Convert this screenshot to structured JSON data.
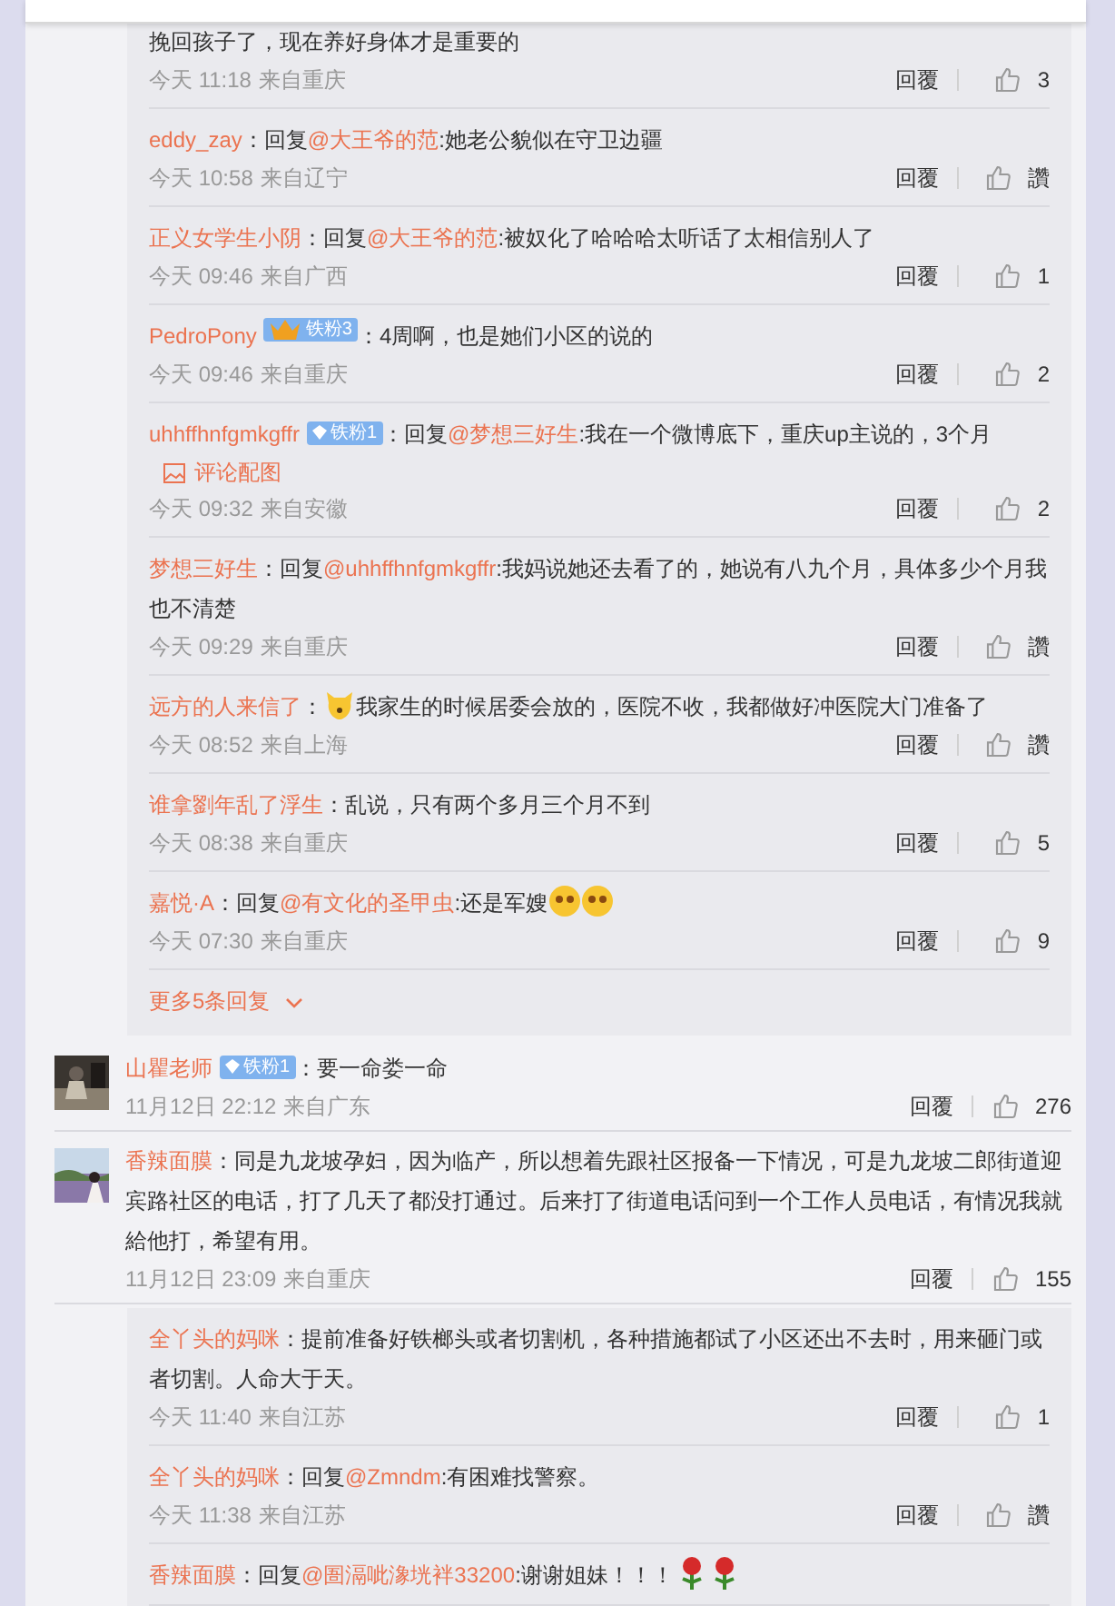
{
  "thread_top": {
    "replies": [
      {
        "content": [
          {
            "kind": "text",
            "text": "挽回孩子了，现在养好身体才是重要的"
          }
        ],
        "time": "今天 11:18",
        "location": "来自重庆",
        "reply": "回覆",
        "likes": "3"
      },
      {
        "author": "eddy_zay",
        "content": [
          {
            "kind": "text",
            "text": "：回复"
          },
          {
            "kind": "mention",
            "text": "@大王爷的范"
          },
          {
            "kind": "text",
            "text": ":她老公貌似在守卫边疆"
          }
        ],
        "time": "今天 10:58",
        "location": "来自辽宁",
        "reply": "回覆",
        "likes": "讚"
      },
      {
        "author": "正义女学生小阴",
        "content": [
          {
            "kind": "text",
            "text": "：回复"
          },
          {
            "kind": "mention",
            "text": "@大王爷的范"
          },
          {
            "kind": "text",
            "text": ":被奴化了哈哈哈太听话了太相信别人了"
          }
        ],
        "time": "今天 09:46",
        "location": "来自广西",
        "reply": "回覆",
        "likes": "1"
      },
      {
        "author": "PedroPony",
        "badge": {
          "kind": "crown",
          "text": "铁粉3"
        },
        "content": [
          {
            "kind": "text",
            "text": "：4周啊，也是她们小区的说的"
          }
        ],
        "time": "今天 09:46",
        "location": "来自重庆",
        "reply": "回覆",
        "likes": "2"
      },
      {
        "author": "uhhffhnfgmkgffr",
        "badge": {
          "kind": "diamond",
          "text": "铁粉1"
        },
        "content": [
          {
            "kind": "text",
            "text": "：回复"
          },
          {
            "kind": "mention",
            "text": "@梦想三好生"
          },
          {
            "kind": "text",
            "text": ":我在一个微博底下，重庆up主说的，3个月"
          }
        ],
        "attachment": "评论配图",
        "time": "今天 09:32",
        "location": "来自安徽",
        "reply": "回覆",
        "likes": "2"
      },
      {
        "author": "梦想三好生",
        "content": [
          {
            "kind": "text",
            "text": "：回复"
          },
          {
            "kind": "mention",
            "text": "@uhhffhnfgmkgffr"
          },
          {
            "kind": "text",
            "text": ":我妈说她还去看了的，她说有八九个月，具体多少个月我也不清楚"
          }
        ],
        "time": "今天 09:29",
        "location": "来自重庆",
        "reply": "回覆",
        "likes": "讚"
      },
      {
        "author": "远方的人来信了",
        "content": [
          {
            "kind": "text",
            "text": "："
          },
          {
            "kind": "dog"
          },
          {
            "kind": "text",
            "text": "我家生的时候居委会放的，医院不收，我都做好冲医院大门准备了"
          }
        ],
        "time": "今天 08:52",
        "location": "来自上海",
        "reply": "回覆",
        "likes": "讚"
      },
      {
        "author": "谁拿劉年乱了浮生",
        "content": [
          {
            "kind": "text",
            "text": "：乱说，只有两个多月三个月不到"
          }
        ],
        "time": "今天 08:38",
        "location": "来自重庆",
        "reply": "回覆",
        "likes": "5"
      },
      {
        "author": "嘉悦·A",
        "content": [
          {
            "kind": "text",
            "text": "：回复"
          },
          {
            "kind": "mention",
            "text": "@有文化的圣甲虫"
          },
          {
            "kind": "text",
            "text": ":还是军嫂"
          },
          {
            "kind": "emoji"
          },
          {
            "kind": "emoji"
          }
        ],
        "time": "今天 07:30",
        "location": "来自重庆",
        "reply": "回覆",
        "likes": "9"
      }
    ],
    "more": "更多5条回复"
  },
  "comments": [
    {
      "author": "山瞿老师",
      "badge": {
        "kind": "diamond",
        "text": "铁粉1"
      },
      "content": [
        {
          "kind": "text",
          "text": "：要一命娄一命"
        }
      ],
      "time": "11月12日 22:12",
      "location": "来自广东",
      "reply": "回覆",
      "likes": "276"
    },
    {
      "author": "香辣面膜",
      "content": [
        {
          "kind": "text",
          "text": "：同是九龙坡孕妇，因为临产，所以想着先跟社区报备一下情况，可是九龙坡二郎街道迎宾路社区的电话，打了几天了都没打通过。后来打了街道电话问到一个工作人员电话，有情况我就給他打，希望有用。"
        }
      ],
      "time": "11月12日 23:09",
      "location": "来自重庆",
      "reply": "回覆",
      "likes": "155"
    }
  ],
  "thread_bottom": {
    "replies": [
      {
        "author": "全丫头的妈咪",
        "content": [
          {
            "kind": "text",
            "text": "：提前准备好铁榔头或者切割机，各种措施都试了小区还出不去时，用来砸门或者切割。人命大于天。"
          }
        ],
        "time": "今天 11:40",
        "location": "来自江苏",
        "reply": "回覆",
        "likes": "1"
      },
      {
        "author": "全丫头的妈咪",
        "content": [
          {
            "kind": "text",
            "text": "：回复"
          },
          {
            "kind": "mention",
            "text": "@Zmndm"
          },
          {
            "kind": "text",
            "text": ":有困难找警察。"
          }
        ],
        "time": "今天 11:38",
        "location": "来自江苏",
        "reply": "回覆",
        "likes": "讚"
      },
      {
        "author": "香辣面膜",
        "content": [
          {
            "kind": "text",
            "text": "：回复"
          },
          {
            "kind": "mention",
            "text": "@圄滆呲潒垙袢33200"
          },
          {
            "kind": "text",
            "text": ":谢谢姐妹！！！"
          },
          {
            "kind": "rose"
          },
          {
            "kind": "rose"
          }
        ]
      }
    ]
  }
}
